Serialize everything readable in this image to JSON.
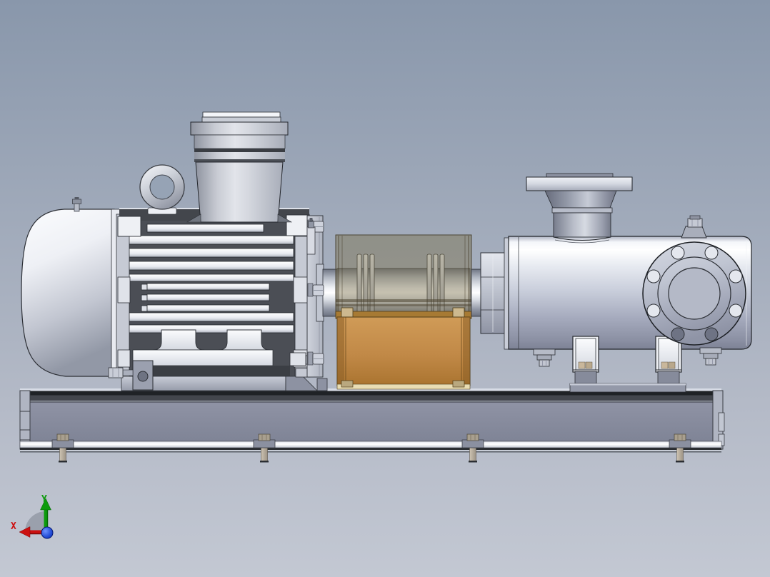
{
  "triad": {
    "x_label": "X",
    "y_label": "Y",
    "x_color": "#cc1111",
    "y_color": "#0c9b0c",
    "z_color": "#1a3fd0"
  },
  "colors": {
    "background_top": "#8997ab",
    "background_bottom": "#c3c8d3",
    "guard_panel": "#c08845",
    "guard_frame": "#8a5f26",
    "metal_light": "#eef0f4",
    "metal_mid": "#b9bec9",
    "metal_dark": "#7e8396",
    "baseplate_web": "#84889b",
    "fin_shadow": "#43464d"
  }
}
